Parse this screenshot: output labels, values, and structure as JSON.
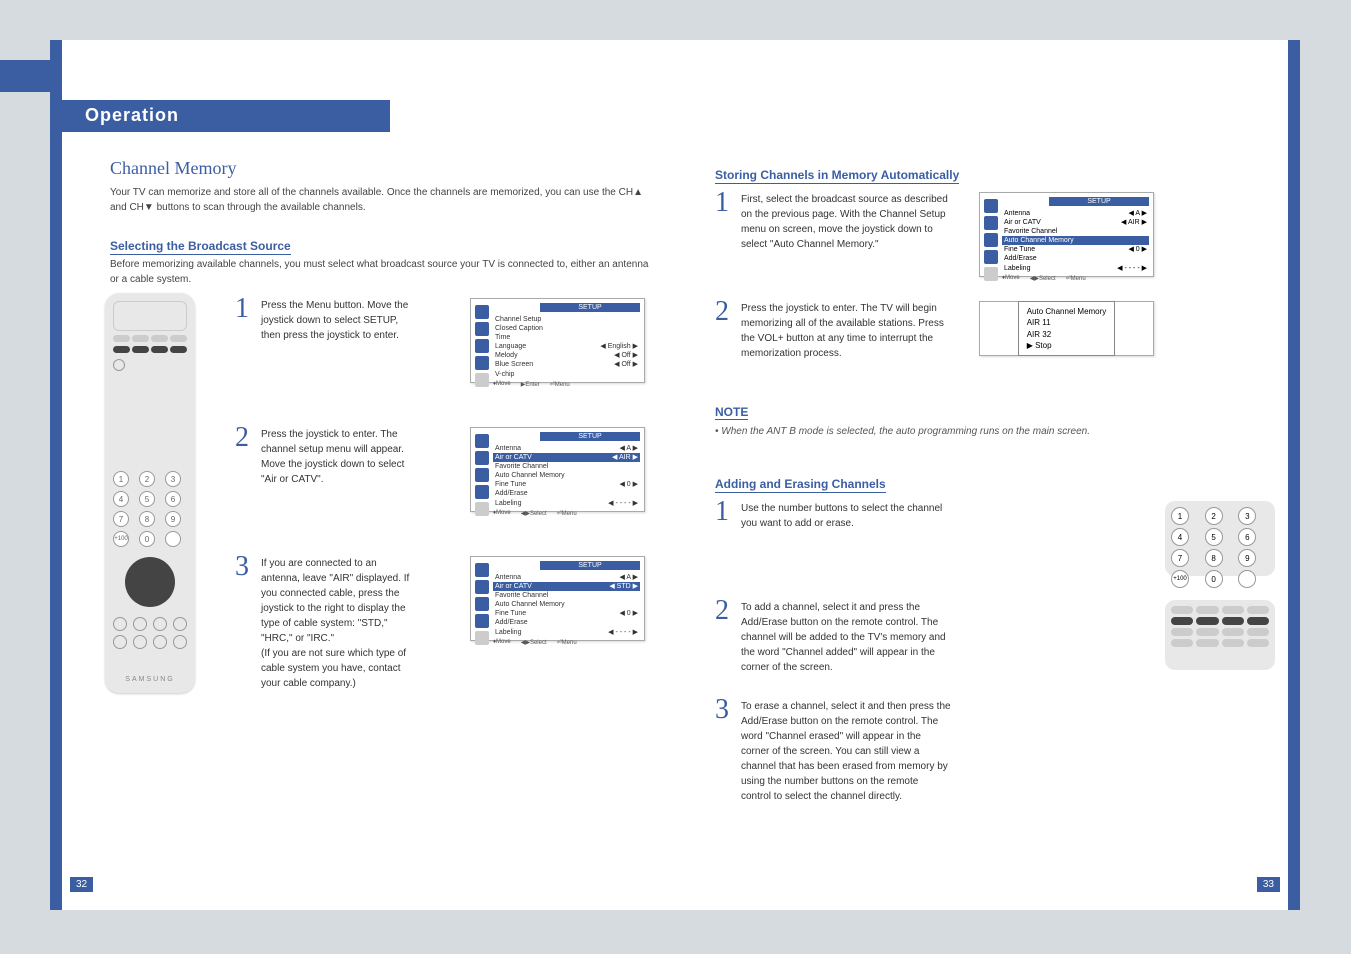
{
  "header": {
    "section_title": "Operation"
  },
  "left": {
    "title": "Channel Memory",
    "intro": "Your TV can memorize and store all of the channels available. Once the channels are memorized, you can use the CH▲ and CH▼ buttons to scan through the available channels.",
    "subhead": "Selecting the Broadcast Source",
    "intro2": "Before memorizing available channels, you must select what broadcast source your TV is connected to, either an antenna or a cable system.",
    "steps": [
      {
        "n": "1",
        "text": "Press the Menu button. Move the joystick down to select SETUP, then press the joystick to enter."
      },
      {
        "n": "2",
        "text": "Press the joystick to enter. The channel setup menu will appear. Move the joystick down to select \"Air or CATV\"."
      },
      {
        "n": "3",
        "text": "If you are connected to an antenna, leave \"AIR\" displayed. If you connected cable, press the joystick to the right to display the type of cable system: \"STD,\" \"HRC,\" or \"IRC.\"\n(If you are not sure which type of cable system you have, contact your cable company.)"
      }
    ],
    "osd1": {
      "title": "SETUP",
      "rows": [
        {
          "k": "Channel Setup",
          "v": ""
        },
        {
          "k": "Closed Caption",
          "v": ""
        },
        {
          "k": "Time",
          "v": ""
        },
        {
          "k": "Language",
          "v": "◀ English ▶"
        },
        {
          "k": "Melody",
          "v": "◀ Off ▶"
        },
        {
          "k": "Blue Screen",
          "v": "◀ Off ▶"
        },
        {
          "k": "V-chip",
          "v": ""
        }
      ],
      "footer": [
        "♦Move",
        "▶Enter",
        "⏎Menu"
      ]
    },
    "osd2": {
      "title": "SETUP",
      "rows": [
        {
          "k": "Antenna",
          "v": "◀ A ▶"
        },
        {
          "k": "Air or CATV",
          "v": "◀ AIR ▶"
        },
        {
          "k": "Favorite Channel",
          "v": ""
        },
        {
          "k": "Auto Channel Memory",
          "v": ""
        },
        {
          "k": "Fine Tune",
          "v": "◀ 0 ▶"
        },
        {
          "k": "Add/Erase",
          "v": ""
        },
        {
          "k": "Labeling",
          "v": "◀ - - - - ▶"
        }
      ],
      "footer": [
        "♦Move",
        "◀▶Select",
        "⏎Menu"
      ]
    },
    "osd3": {
      "title": "SETUP",
      "rows": [
        {
          "k": "Antenna",
          "v": "◀ A ▶"
        },
        {
          "k": "Air or CATV",
          "v": "◀ STD ▶"
        },
        {
          "k": "Favorite Channel",
          "v": ""
        },
        {
          "k": "Auto Channel Memory",
          "v": ""
        },
        {
          "k": "Fine Tune",
          "v": "◀ 0 ▶"
        },
        {
          "k": "Add/Erase",
          "v": ""
        },
        {
          "k": "Labeling",
          "v": "◀ - - - - ▶"
        }
      ],
      "footer": [
        "♦Move",
        "◀▶Select",
        "⏎Menu"
      ]
    },
    "remote_brand": "SAMSUNG",
    "pagenum": "32"
  },
  "right": {
    "subhead1": "Storing Channels in Memory Automatically",
    "steps1": [
      {
        "n": "1",
        "text": "First, select the broadcast source as described on the previous page. With the Channel Setup menu on screen, move the joystick down to select \"Auto Channel Memory.\""
      },
      {
        "n": "2",
        "text": "Press the joystick to enter. The TV will begin memorizing all of the available stations. Press the VOL+ button at any time to interrupt the memorization process."
      }
    ],
    "osd_r1": {
      "title": "SETUP",
      "rows": [
        {
          "k": "Antenna",
          "v": "◀ A ▶"
        },
        {
          "k": "Air or CATV",
          "v": "◀ AIR ▶"
        },
        {
          "k": "Favorite Channel",
          "v": ""
        },
        {
          "k": "Auto Channel Memory",
          "v": ""
        },
        {
          "k": "Fine Tune",
          "v": "◀ 0 ▶"
        },
        {
          "k": "Add/Erase",
          "v": ""
        },
        {
          "k": "Labeling",
          "v": "◀ - - - - ▶"
        }
      ],
      "footer": [
        "♦Move",
        "◀▶Select",
        "⏎Menu"
      ]
    },
    "osd_r2": {
      "l1": "Auto Channel Memory",
      "l2": "AIR 11",
      "l3": "AIR 32",
      "l4": "▶     Stop"
    },
    "note_title": "NOTE",
    "note_body": "• When the ANT B mode is selected, the auto programming runs on the main screen.",
    "subhead2": "Adding and Erasing Channels",
    "steps2": [
      {
        "n": "1",
        "text": "Use the number buttons to select the channel you want to add or erase."
      },
      {
        "n": "2",
        "text": "To add a channel, select it and press the Add/Erase button on the remote control. The channel will be added to the TV's memory and the word \"Channel added\" will appear in the corner of the screen."
      },
      {
        "n": "3",
        "text": "To erase a channel, select it and then press the Add/Erase button on the remote control. The word \"Channel erased\" will appear in the corner of the screen. You can still view a channel that has been erased from memory by using the number buttons on the remote control to select the channel directly."
      }
    ],
    "pagenum": "33"
  }
}
